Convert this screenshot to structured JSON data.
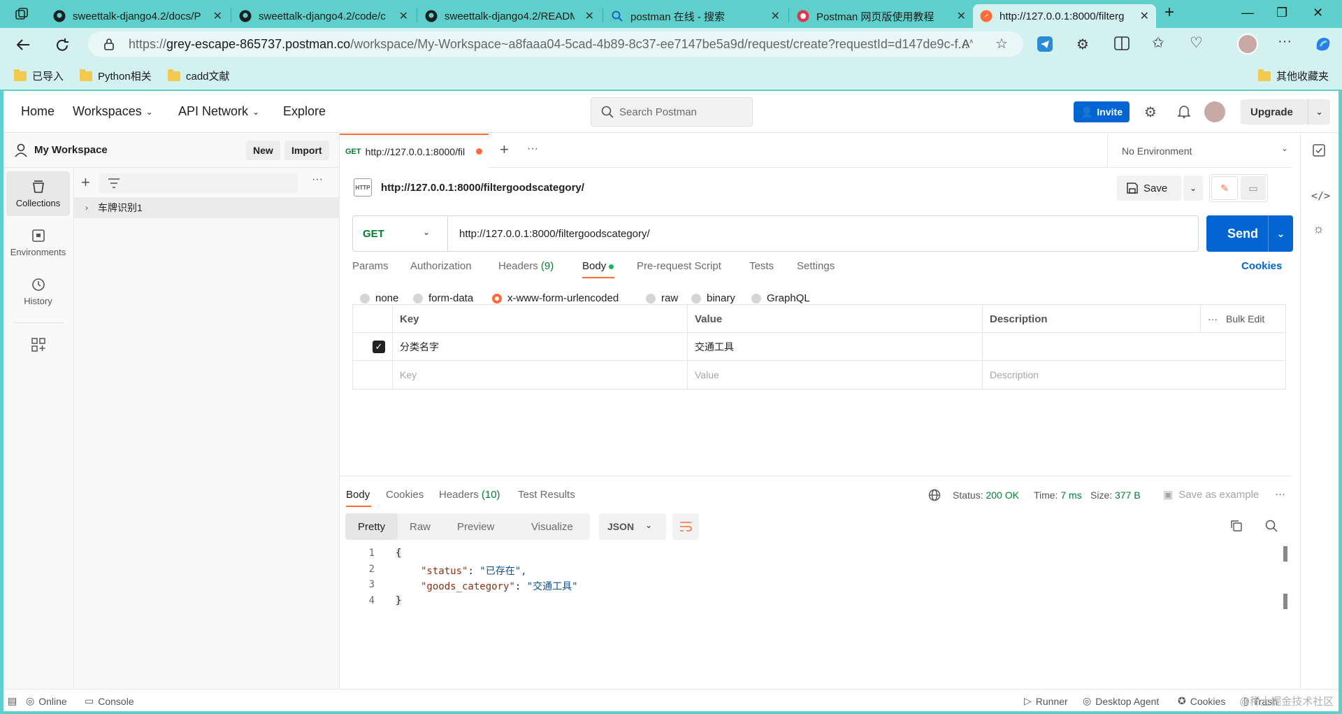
{
  "browser": {
    "tabs": [
      {
        "title": "sweettalk-django4.2/docs/P",
        "icon": "github-icon"
      },
      {
        "title": "sweettalk-django4.2/code/c",
        "icon": "github-icon"
      },
      {
        "title": "sweettalk-django4.2/READM",
        "icon": "github-icon"
      },
      {
        "title": "postman 在线 - 搜索",
        "icon": "search-icon"
      },
      {
        "title": "Postman 网页版使用教程",
        "icon": "csdn-icon"
      },
      {
        "title": "http://127.0.0.1:8000/filterg",
        "icon": "postman-icon"
      }
    ],
    "address": {
      "scheme": "https://",
      "host": "grey-escape-865737.postman.co",
      "path": "/workspace/My-Workspace~a8faaa04-5cad-4b89-8c37-ee7147be5a9d/request/create?requestId=d147de9c-f..."
    },
    "bookmarks": [
      "已导入",
      "Python相关",
      "cadd文献"
    ],
    "other_bookmarks": "其他收藏夹"
  },
  "topnav": {
    "home": "Home",
    "workspaces": "Workspaces",
    "api_network": "API Network",
    "explore": "Explore",
    "search_placeholder": "Search Postman",
    "invite": "Invite",
    "upgrade": "Upgrade"
  },
  "leftbar": {
    "items": [
      {
        "label": "Collections",
        "icon": "collections-icon"
      },
      {
        "label": "Environments",
        "icon": "environments-icon"
      },
      {
        "label": "History",
        "icon": "history-icon"
      }
    ]
  },
  "sidebar": {
    "workspace_name": "My Workspace",
    "new_label": "New",
    "import_label": "Import",
    "collections": [
      {
        "name": "车牌识别1"
      }
    ]
  },
  "request_tab": {
    "method": "GET",
    "title": "http://127.0.0.1:8000/fil"
  },
  "environment": "No Environment",
  "request": {
    "name": "http://127.0.0.1:8000/filtergoodscategory/",
    "method": "GET",
    "url": "http://127.0.0.1:8000/filtergoodscategory/",
    "save_label": "Save",
    "send_label": "Send",
    "tabs": [
      "Params",
      "Authorization",
      "Headers",
      "Body",
      "Pre-request Script",
      "Tests",
      "Settings"
    ],
    "headers_count": "(9)",
    "active_tab": "Body",
    "cookies_label": "Cookies",
    "body_types": [
      "none",
      "form-data",
      "x-www-form-urlencoded",
      "raw",
      "binary",
      "GraphQL"
    ],
    "selected_body_type": "x-www-form-urlencoded",
    "table_headers": {
      "key": "Key",
      "value": "Value",
      "description": "Description",
      "bulk_edit": "Bulk Edit"
    },
    "rows": [
      {
        "key": "分类名字",
        "value": "交通工具",
        "description": "",
        "checked": true
      }
    ],
    "placeholders": {
      "key": "Key",
      "value": "Value",
      "description": "Description"
    }
  },
  "response": {
    "tabs": [
      "Body",
      "Cookies",
      "Headers",
      "Test Results"
    ],
    "headers_count": "(10)",
    "status_label": "Status:",
    "status_value": "200 OK",
    "time_label": "Time:",
    "time_value": "7 ms",
    "size_label": "Size:",
    "size_value": "377 B",
    "save_example": "Save as example",
    "views": [
      "Pretty",
      "Raw",
      "Preview",
      "Visualize"
    ],
    "format": "JSON",
    "code_lines": [
      {
        "n": "1",
        "text": "{"
      },
      {
        "n": "2",
        "key": "\"status\"",
        "val": "\"已存在\","
      },
      {
        "n": "3",
        "key": "\"goods_category\"",
        "val": "\"交通工具\""
      },
      {
        "n": "4",
        "text": "}"
      }
    ]
  },
  "statusbar": {
    "online": "Online",
    "console": "Console",
    "runner": "Runner",
    "desktop_agent": "Desktop Agent",
    "cookies": "Cookies",
    "trash": "Trash",
    "watermark": "@稀土掘金技术社区"
  },
  "colors": {
    "accent": "#ff6c37",
    "primary": "#0265d2",
    "get": "#007f31",
    "chrome": "#5ecfca"
  }
}
